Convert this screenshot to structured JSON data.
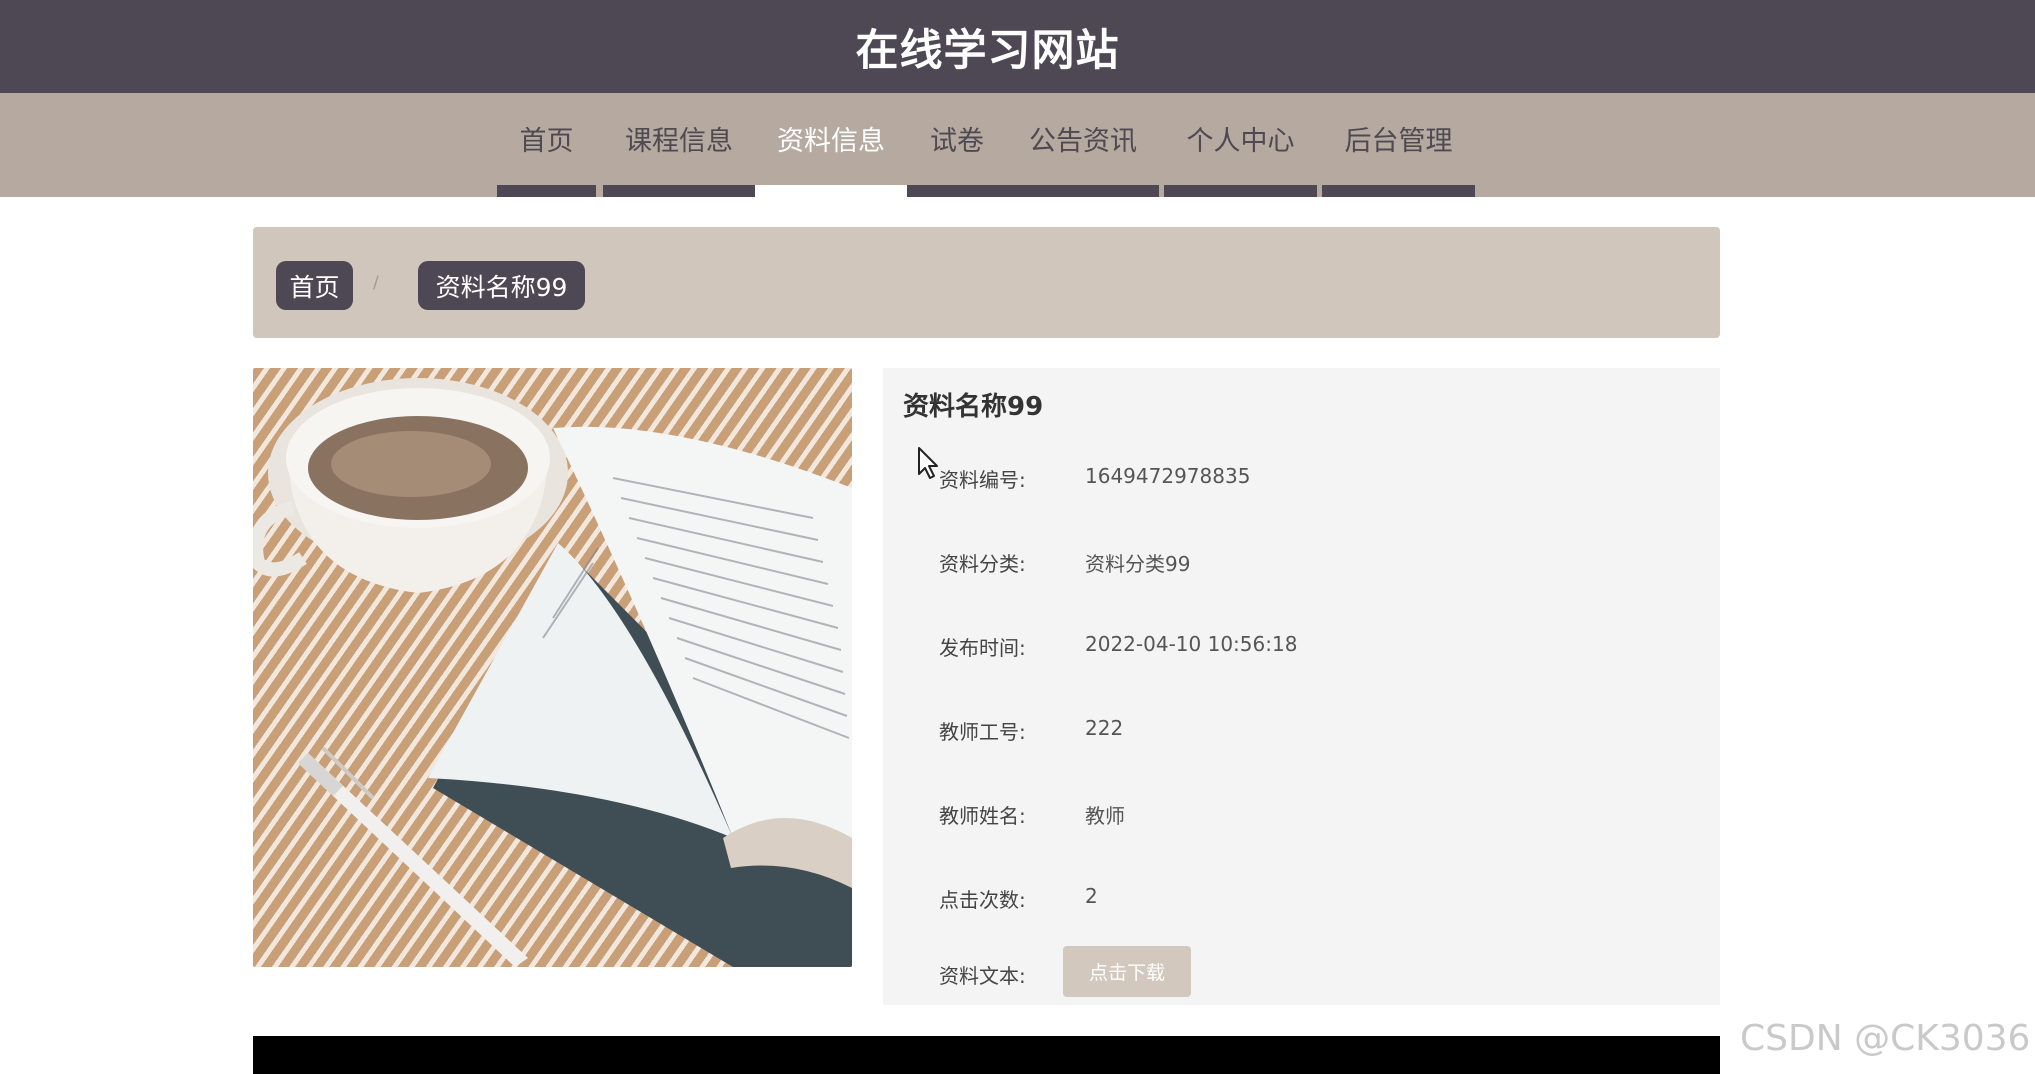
{
  "header": {
    "title": "在线学习网站"
  },
  "nav": {
    "items": [
      {
        "label": "首页"
      },
      {
        "label": "课程信息"
      },
      {
        "label": "资料信息",
        "active": true
      },
      {
        "label": "试卷"
      },
      {
        "label": "公告资讯"
      },
      {
        "label": "个人中心"
      },
      {
        "label": "后台管理"
      }
    ]
  },
  "breadcrumb": {
    "home": "首页",
    "separator": "/",
    "current": "资料名称99"
  },
  "detail": {
    "title": "资料名称99",
    "fields": [
      {
        "label": "资料编号:",
        "value": "1649472978835"
      },
      {
        "label": "资料分类:",
        "value": "资料分类99"
      },
      {
        "label": "发布时间:",
        "value": "2022-04-10 10:56:18"
      },
      {
        "label": "教师工号:",
        "value": "222"
      },
      {
        "label": "教师姓名:",
        "value": "教师"
      },
      {
        "label": "点击次数:",
        "value": "2"
      }
    ],
    "file_label": "资料文本:",
    "download_label": "点击下载"
  },
  "watermark": "CSDN @CK3036",
  "colors": {
    "header_bg": "#4e4854",
    "nav_bg": "#b5a9a0",
    "breadcrumb_bg": "#d0c6bb",
    "panel_bg": "#f4f4f4",
    "button_bg": "#d3c8bd"
  }
}
